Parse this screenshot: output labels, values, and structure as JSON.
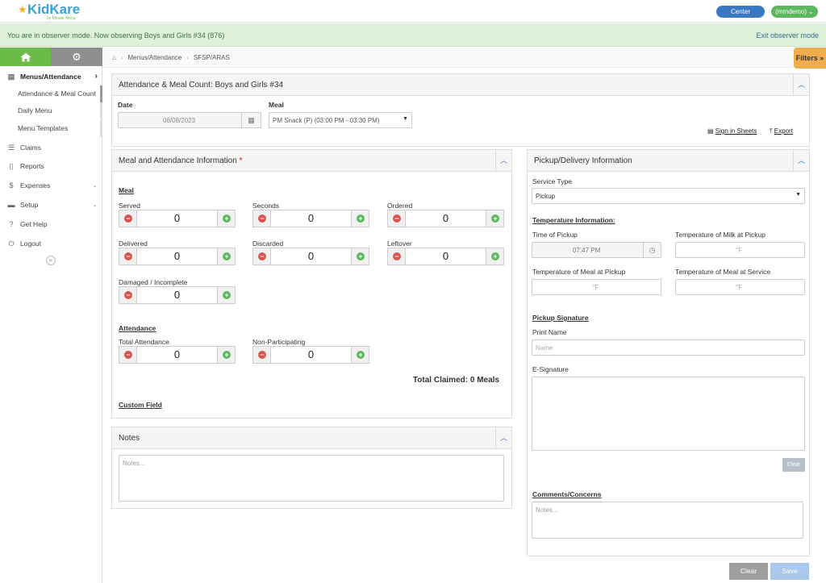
{
  "header": {
    "logo_text": "KidKare",
    "logo_sub": "by Minute Menu",
    "center_button": "Center",
    "user_button": "(mmdemo) ⌄"
  },
  "observer": {
    "message": "You are in observer mode. Now observing Boys and Girls #34 (876)",
    "exit": "Exit observer mode"
  },
  "sidebar": {
    "nav": [
      {
        "label": "Menus/Attendance",
        "icon": "clipboard-icon"
      },
      {
        "label": "Claims",
        "icon": "list-icon"
      },
      {
        "label": "Reports",
        "icon": "document-icon"
      },
      {
        "label": "Expenses",
        "icon": "dollar-icon"
      },
      {
        "label": "Setup",
        "icon": "briefcase-icon"
      },
      {
        "label": "Get Help",
        "icon": "help-icon"
      },
      {
        "label": "Logout",
        "icon": "power-icon"
      }
    ],
    "sub": [
      "Attendance & Meal Count",
      "Daily Menu",
      "Menu Templates"
    ]
  },
  "breadcrumb": {
    "items": [
      "Menus/Attendance",
      "SFSP/ARAS"
    ]
  },
  "filters": "Filters »",
  "main_panel": {
    "title": "Attendance & Meal Count: Boys and Girls #34",
    "date_label": "Date",
    "date_value": "06/08/2023",
    "meal_label": "Meal",
    "meal_value": "PM Snack (P) (03:00 PM - 03:30 PM)",
    "sign_in_sheets": "Sign in Sheets",
    "export": "Export"
  },
  "meal_panel": {
    "title": "Meal and Attendance Information",
    "required": "*",
    "meal_section": "Meal",
    "counters": [
      {
        "label": "Served",
        "value": "0"
      },
      {
        "label": "Seconds",
        "value": "0"
      },
      {
        "label": "Ordered",
        "value": "0"
      },
      {
        "label": "Delivered",
        "value": "0"
      },
      {
        "label": "Discarded",
        "value": "0"
      },
      {
        "label": "Leftover",
        "value": "0"
      },
      {
        "label": "Damaged / Incomplete",
        "value": "0"
      }
    ],
    "attendance_section": "Attendance",
    "attendance": [
      {
        "label": "Total Attendance",
        "value": "0"
      },
      {
        "label": "Non-Participating",
        "value": "0"
      }
    ],
    "total_claimed": "Total Claimed: 0 Meals",
    "custom_field": "Custom Field"
  },
  "notes_panel": {
    "title": "Notes",
    "placeholder": "Notes..."
  },
  "pickup_panel": {
    "title": "Pickup/Delivery Information",
    "service_type_label": "Service Type",
    "service_type_value": "Pickup",
    "temp_section": "Temperature Information:",
    "time_pickup_label": "Time of Pickup",
    "time_pickup_value": "07:47 PM",
    "temp_milk_label": "Temperature of Milk at Pickup",
    "temp_milk_ph": "°F",
    "temp_meal_pickup_label": "Temperature of Meal at Pickup",
    "temp_meal_pickup_ph": "°F",
    "temp_meal_service_label": "Temperature of Meal at Service",
    "temp_meal_service_ph": "°F",
    "signature_section": "Pickup Signature",
    "print_name_label": "Print Name",
    "print_name_ph": "Name",
    "esig_label": "E-Signature",
    "clear_sig": "Clear",
    "comments_section": "Comments/Concerns",
    "comments_ph": "Notes..."
  },
  "footer": {
    "clear": "Clear",
    "save": "Save"
  },
  "colors": {
    "green": "#6abb47",
    "blue": "#3a78c3",
    "observer_bg": "#dff0d8",
    "filters": "#f0ad4e"
  }
}
